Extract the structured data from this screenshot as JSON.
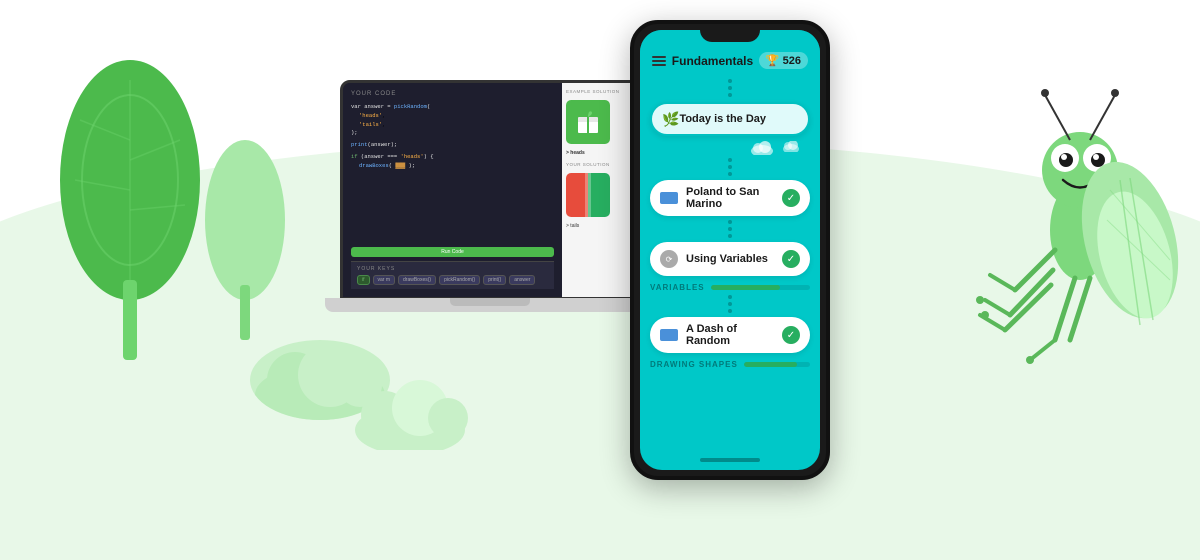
{
  "background": {
    "color": "#ffffff",
    "arc_color": "#e8f8e8"
  },
  "phone": {
    "header": {
      "title": "Fundamentals",
      "score": "526"
    },
    "lessons": [
      {
        "id": "today",
        "label": "Today is the Day",
        "type": "featured",
        "completed": false,
        "icon_color": "none"
      },
      {
        "id": "poland",
        "label": "Poland to San Marino",
        "type": "normal",
        "completed": true,
        "icon_color": "blue"
      },
      {
        "id": "variables",
        "label": "Using Variables",
        "type": "normal",
        "completed": true,
        "icon_color": "gray"
      },
      {
        "id": "dash",
        "label": "A Dash of Random",
        "type": "normal",
        "completed": true,
        "icon_color": "blue"
      }
    ],
    "sections": [
      {
        "id": "variables",
        "label": "VARIABLES",
        "progress": 70
      },
      {
        "id": "drawing",
        "label": "DRAWING SHAPES",
        "progress": 80
      }
    ]
  },
  "laptop": {
    "code_label": "YOUR CODE",
    "code_lines": [
      "var answer = pickRandom(",
      "  'heads',",
      "  'tails',",
      ");",
      "",
      "print(answer);",
      "",
      "if (answer === 'heads') {",
      "  drawBoxes( ▓▓▓ ▓▓▓ );"
    ],
    "run_button": "Run Code",
    "keys_label": "YOUR KEYS",
    "example_label": "EXAMPLE SOLUTION",
    "your_solution_label": "YOUR SOLUTION",
    "output_heads": "> heads",
    "output_tails": "> tails"
  },
  "trees": {
    "big_color": "#4cba4c",
    "small_color": "#a8e8a8"
  },
  "grasshopper": {
    "body_color": "#7dd87d",
    "eye_color": "#ffffff"
  }
}
